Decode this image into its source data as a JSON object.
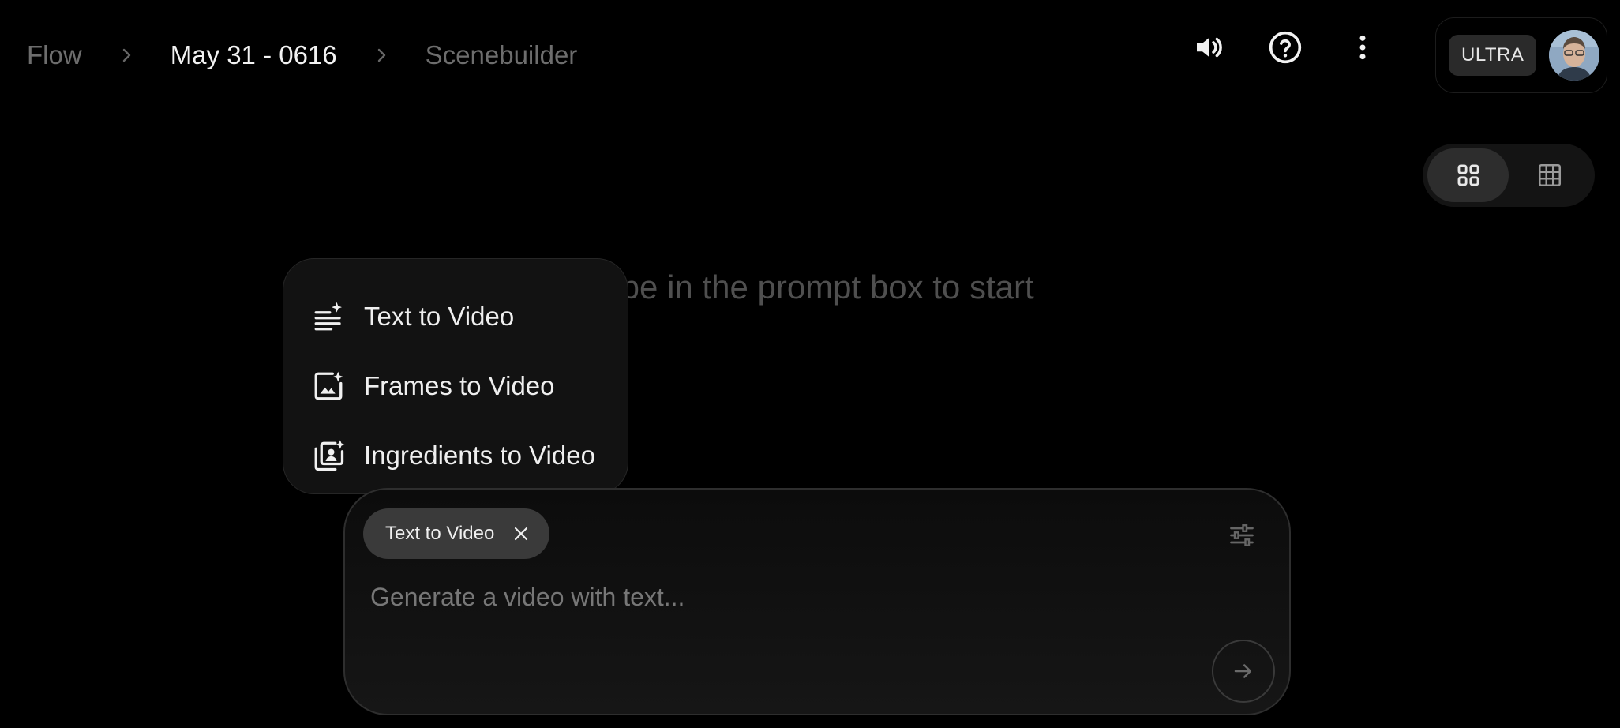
{
  "breadcrumb": {
    "items": [
      "Flow",
      "May 31 - 0616",
      "Scenebuilder"
    ]
  },
  "header": {
    "icons": [
      "volume-icon",
      "help-icon",
      "more-vert-icon"
    ]
  },
  "account": {
    "tier": "ULTRA"
  },
  "view_toggle": {
    "active": "grid-large",
    "options": [
      "grid-large-icon",
      "grid-small-icon"
    ]
  },
  "empty_state": {
    "hint": "Type in the prompt box to start"
  },
  "mode_menu": {
    "items": [
      {
        "label": "Text to Video",
        "icon": "text-sparkle-icon"
      },
      {
        "label": "Frames to Video",
        "icon": "image-sparkle-icon"
      },
      {
        "label": "Ingredients to Video",
        "icon": "ingredients-sparkle-icon"
      }
    ]
  },
  "prompt": {
    "mode_chip": "Text to Video",
    "placeholder": "Generate a video with text...",
    "value": ""
  },
  "colors": {
    "background": "#000000",
    "menu_bg": "#121212",
    "chip_bg": "#3a3a3a",
    "muted_text": "#6d6d6d"
  }
}
